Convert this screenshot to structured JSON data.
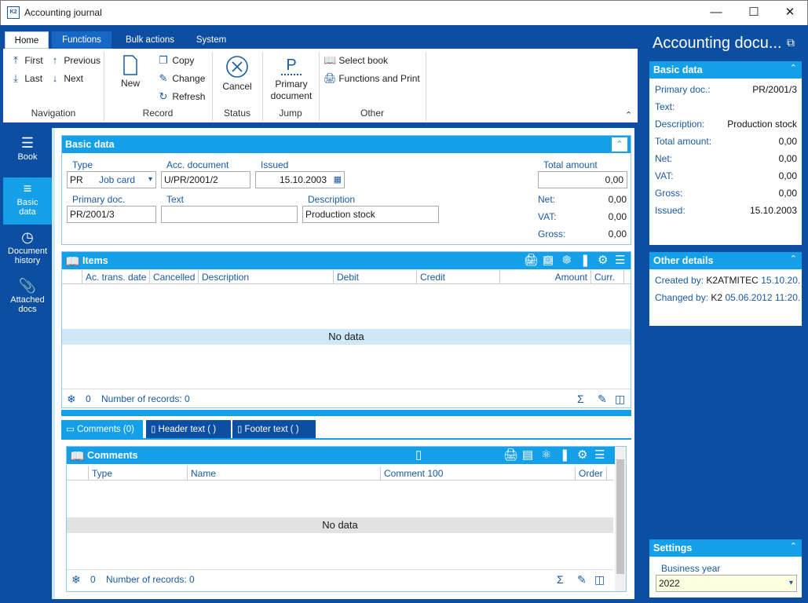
{
  "window": {
    "title": "Accounting journal",
    "logo": "K2"
  },
  "ribbon": {
    "tabs": [
      "Home",
      "Functions",
      "Bulk actions",
      "System"
    ],
    "nav": {
      "first": "First",
      "previous": "Previous",
      "last": "Last",
      "next": "Next",
      "group": "Navigation"
    },
    "record": {
      "new": "New",
      "copy": "Copy",
      "change": "Change",
      "refresh": "Refresh",
      "group": "Record"
    },
    "status": {
      "cancel": "Cancel",
      "group": "Status"
    },
    "jump": {
      "primary": "Primary document",
      "primary_icon": "P",
      "group": "Jump"
    },
    "other": {
      "select_book": "Select book",
      "functions_print": "Functions and Print",
      "group": "Other"
    }
  },
  "leftnav": [
    {
      "label": "Book",
      "icon": "menu-icon"
    },
    {
      "label": "Basic data",
      "icon": "list-icon"
    },
    {
      "label": "Document history",
      "icon": "clock-icon"
    },
    {
      "label": "Attached docs",
      "icon": "paperclip-icon"
    }
  ],
  "basic": {
    "header": "Basic data",
    "type_label": "Type",
    "type_value": "PR",
    "type_desc": "Job card",
    "accdoc_label": "Acc. document",
    "accdoc_value": "U/PR/2001/2",
    "issued_label": "Issued",
    "issued_value": "15.10.2003",
    "total_label": "Total amount",
    "total_value": "0,00",
    "primary_label": "Primary doc.",
    "primary_value": "PR/2001/3",
    "text_label": "Text",
    "text_value": "",
    "desc_label": "Description",
    "desc_value": "Production stock",
    "net_label": "Net:",
    "net_value": "0,00",
    "vat_label": "VAT:",
    "vat_value": "0,00",
    "gross_label": "Gross:",
    "gross_value": "0,00"
  },
  "items": {
    "header": "Items",
    "columns": [
      "Ac. trans. date",
      "Cancelled",
      "Description",
      "Debit",
      "Credit",
      "Amount",
      "Curr."
    ],
    "nodata": "No data",
    "count": "0",
    "records": "Number of records: 0"
  },
  "tabs": [
    "Comments (0)",
    "Header text ( )",
    "Footer text ( )"
  ],
  "comments": {
    "header": "Comments",
    "columns": [
      "Type",
      "Name",
      "Comment 100",
      "Order"
    ],
    "nodata": "No data",
    "count": "0",
    "records": "Number of records: 0"
  },
  "right": {
    "title": "Accounting docu...",
    "basic": {
      "header": "Basic data",
      "rows": [
        {
          "k": "Primary doc.:",
          "v": "PR/2001/3"
        },
        {
          "k": "Text:",
          "v": ""
        },
        {
          "k": "Description:",
          "v": "Production stock"
        },
        {
          "k": "Total amount:",
          "v": "0,00"
        },
        {
          "k": "Net:",
          "v": "0,00"
        },
        {
          "k": "VAT:",
          "v": "0,00"
        },
        {
          "k": "Gross:",
          "v": "0,00"
        },
        {
          "k": "Issued:",
          "v": "15.10.2003"
        }
      ]
    },
    "other": {
      "header": "Other details",
      "created_label": "Created by:",
      "created_user": "K2ATMITEC",
      "created_date": "15.10.20...",
      "changed_label": "Changed by:",
      "changed_user": "K2",
      "changed_date": "05.06.2012 11:20..."
    },
    "settings": {
      "header": "Settings",
      "year_label": "Business year",
      "year_value": "2022"
    }
  }
}
